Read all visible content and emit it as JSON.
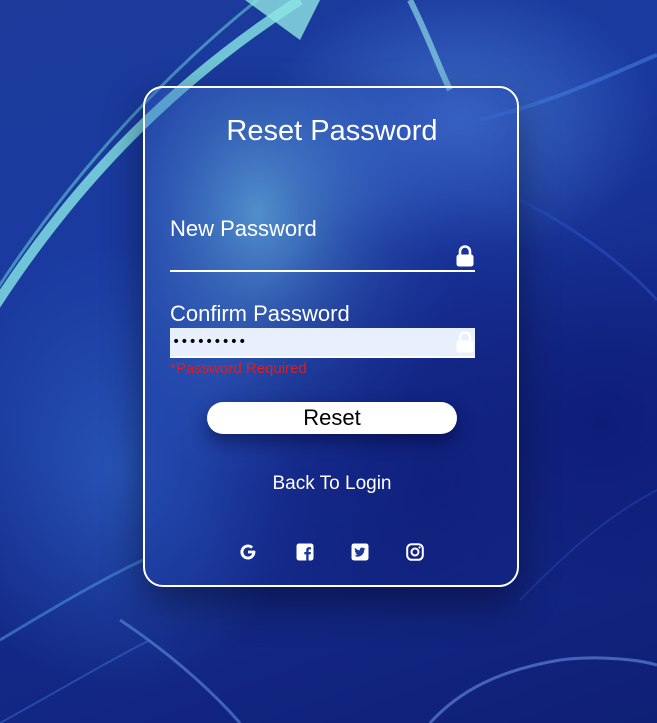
{
  "form": {
    "title": "Reset Password",
    "new_password": {
      "label": "New Password",
      "value": ""
    },
    "confirm_password": {
      "label": "Confirm Password",
      "value": "•••••••••"
    },
    "error_message": "*Password Required",
    "reset_label": "Reset",
    "back_link_label": "Back To Login"
  },
  "socials": [
    {
      "name": "google",
      "icon": "google-icon"
    },
    {
      "name": "facebook",
      "icon": "facebook-icon"
    },
    {
      "name": "twitter",
      "icon": "twitter-icon"
    },
    {
      "name": "instagram",
      "icon": "instagram-icon"
    }
  ],
  "colors": {
    "background": "#1a3aa0",
    "error": "#e21c1c",
    "autofill": "#e8f0fe",
    "text": "#ffffff"
  }
}
